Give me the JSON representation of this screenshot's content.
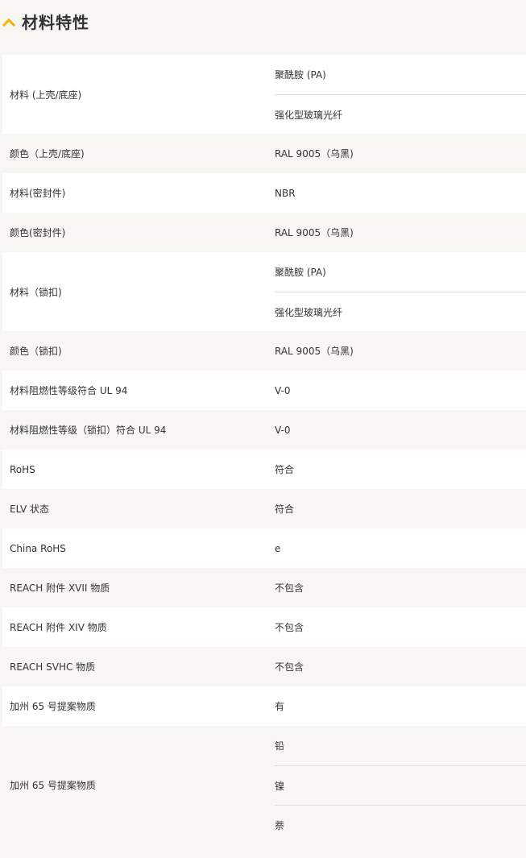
{
  "section": {
    "title": "材料特性",
    "accent_color": "#f4b400"
  },
  "rows": [
    {
      "label": "材料 (上壳/底座)",
      "values": [
        "聚酰胺 (PA)",
        "强化型玻璃光纤"
      ]
    },
    {
      "label": "颜色（上壳/底座)",
      "values": [
        "RAL 9005（乌黑)"
      ]
    },
    {
      "label": "材料(密封件)",
      "values": [
        "NBR"
      ]
    },
    {
      "label": "颜色(密封件)",
      "values": [
        "RAL 9005（乌黑)"
      ]
    },
    {
      "label": "材料（锁扣)",
      "values": [
        "聚酰胺 (PA)",
        "强化型玻璃光纤"
      ]
    },
    {
      "label": "颜色（锁扣)",
      "values": [
        "RAL 9005（乌黑)"
      ]
    },
    {
      "label": "材料阻燃性等级符合 UL 94",
      "values": [
        "V-0"
      ]
    },
    {
      "label": "材料阻燃性等级（锁扣）符合 UL 94",
      "values": [
        "V-0"
      ]
    },
    {
      "label": "RoHS",
      "values": [
        "符合"
      ]
    },
    {
      "label": "ELV 状态",
      "values": [
        "符合"
      ]
    },
    {
      "label": "China RoHS",
      "values": [
        "e"
      ]
    },
    {
      "label": "REACH 附件 XVII 物质",
      "values": [
        "不包含"
      ]
    },
    {
      "label": "REACH 附件 XIV 物质",
      "values": [
        "不包含"
      ]
    },
    {
      "label": "REACH SVHC 物质",
      "values": [
        "不包含"
      ]
    },
    {
      "label": "加州 65 号提案物质",
      "values": [
        "有"
      ]
    },
    {
      "label": "加州 65 号提案物质",
      "values": [
        "铅",
        "镍",
        "萘"
      ]
    }
  ]
}
